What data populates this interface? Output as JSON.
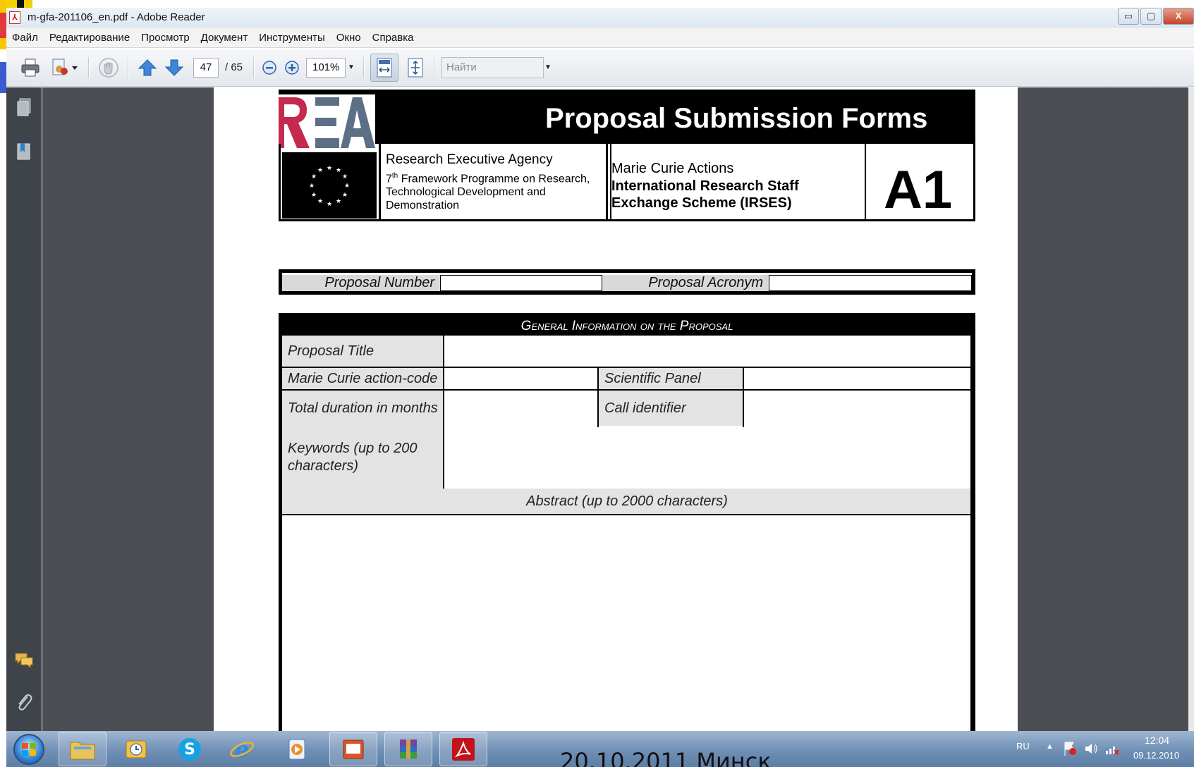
{
  "window": {
    "title": "m-gfa-201106_en.pdf - Adobe Reader",
    "buttons": {
      "minimize": "▭",
      "maximize": "▢",
      "close": "X"
    }
  },
  "menu": [
    "Файл",
    "Редактирование",
    "Просмотр",
    "Документ",
    "Инструменты",
    "Окно",
    "Справка"
  ],
  "toolbar": {
    "page_current": "47",
    "page_total": "/ 65",
    "zoom": "101%",
    "search_placeholder": "Найти"
  },
  "document": {
    "title": "Proposal Submission Forms",
    "agency": "Research Executive Agency",
    "fp_sup": "th",
    "fp_num": "7",
    "fp_text": " Framework Programme on Research, Technological Development and Demonstration",
    "action_line1": "Marie Curie Actions",
    "action_line2": "International Research Staff Exchange Scheme (IRSES)",
    "form_code": "A1",
    "proposal_number_label": "Proposal Number",
    "proposal_acronym_label": "Proposal Acronym",
    "general_info_heading": "General Information on the Proposal",
    "fields": {
      "proposal_title": "Proposal Title",
      "action_code": "Marie Curie action-code",
      "scientific_panel": "Scientific Panel",
      "duration": "Total duration in months",
      "call_identifier": "Call identifier",
      "keywords": "Keywords (up to 200 characters)",
      "abstract": "Abstract (up to 2000 characters)"
    }
  },
  "taskbar": {
    "language": "RU",
    "time": "12:04",
    "date": "09.12.2010"
  },
  "slide_footer": "20.10.2011 Минск"
}
